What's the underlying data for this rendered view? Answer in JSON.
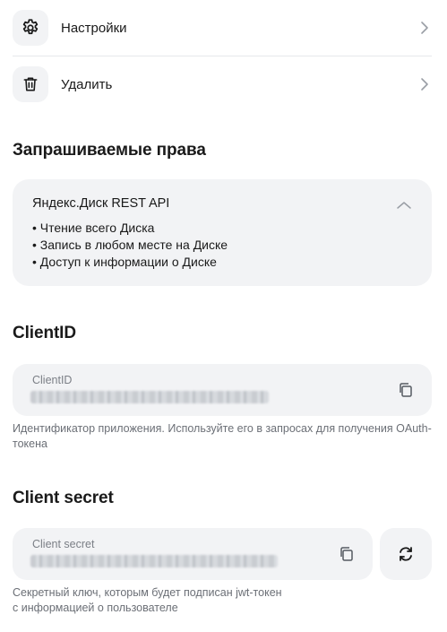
{
  "menu": {
    "settings": {
      "label": "Настройки",
      "icon": "gear-icon"
    },
    "delete": {
      "label": "Удалить",
      "icon": "trash-icon"
    }
  },
  "permissions": {
    "heading": "Запрашиваемые права",
    "card_title": "Яндекс.Диск REST API",
    "items": [
      "Чтение всего Диска",
      "Запись в любом месте на Диске",
      "Доступ к информации о Диске"
    ],
    "expanded": true
  },
  "client_id": {
    "heading": "ClientID",
    "label": "ClientID",
    "value_blurred": true,
    "hint": "Идентификатор приложения. Используйте его в запросах для получения OAuth-токена"
  },
  "client_secret": {
    "heading": "Client secret",
    "label": "Client secret",
    "value_blurred": true,
    "hint_line1": "Секретный ключ, которым будет подписан jwt-токен",
    "hint_line2": "с информацией о пользователе"
  },
  "colors": {
    "card_bg": "#f2f3f5",
    "text": "#1a1a1a",
    "muted": "#6b6f76"
  }
}
